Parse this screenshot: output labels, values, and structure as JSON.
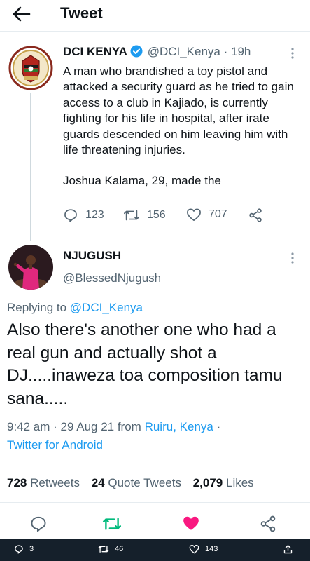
{
  "header": {
    "title": "Tweet"
  },
  "tweet1": {
    "name": "DCI KENYA",
    "handle": "@DCI_Kenya",
    "time": "· 19h",
    "text": "A man who brandished a toy pistol and attacked a security guard as he tried to gain access to a club in Kajiado, is currently fighting for his life in hospital, after irate guards descended on him leaving him with life threatening injuries.",
    "trail": "Joshua Kalama, 29, made the",
    "replies": "123",
    "retweets": "156",
    "likes": "707"
  },
  "tweet2": {
    "name": "NJUGUSH",
    "handle": "@BlessedNjugush",
    "replying_prefix": "Replying to",
    "replying_handle": "@DCI_Kenya",
    "text": "Also there's another one who had a real gun and actually shot a DJ.....inaweza toa composition tamu sana.....",
    "time": "9:42 am · 29 Aug 21 from",
    "location": "Ruiru, Kenya",
    "sep": "·",
    "source": "Twitter for Android"
  },
  "stats": {
    "retweets_count": "728",
    "retweets_label": "Retweets",
    "quotes_count": "24",
    "quotes_label": "Quote Tweets",
    "likes_count": "2,079",
    "likes_label": "Likes"
  },
  "bottom_bar": {
    "replies": "3",
    "retweets": "46",
    "likes": "143"
  },
  "colors": {
    "accent": "#1d9bf0",
    "like_active": "#f91880",
    "retweet_active": "#00ba7c",
    "muted": "#536471",
    "bar_bg": "#15202b"
  },
  "icons": [
    "back-arrow-icon",
    "verified-badge-icon",
    "more-icon",
    "reply-icon",
    "retweet-icon",
    "like-icon",
    "share-icon",
    "upload-icon"
  ]
}
